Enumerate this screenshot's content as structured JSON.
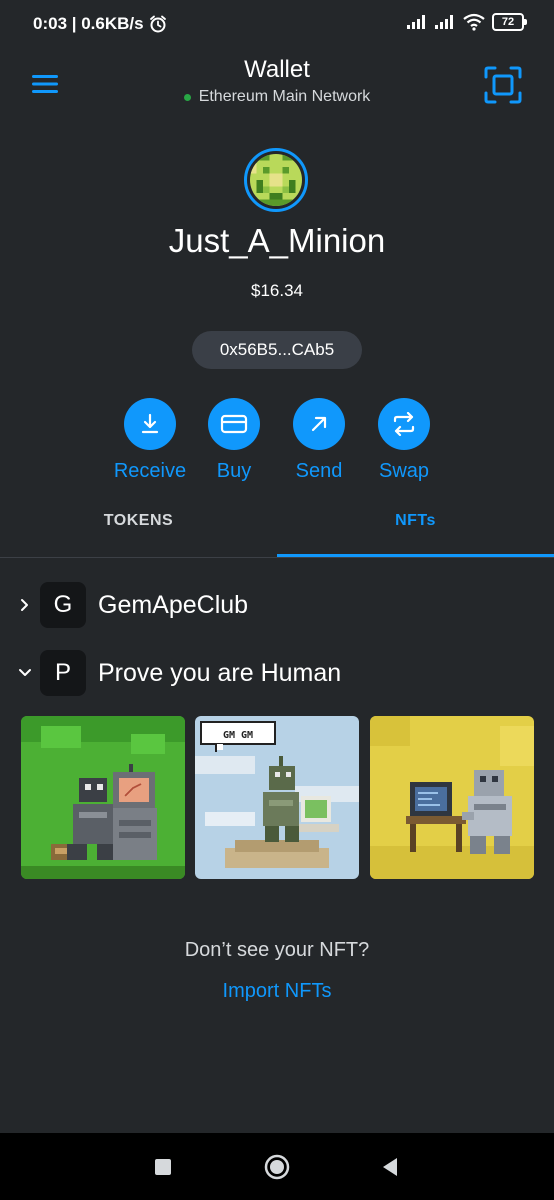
{
  "status_bar": {
    "time_speed": "0:03 | 0.6KB/s",
    "battery": "72"
  },
  "header": {
    "title": "Wallet",
    "network": "Ethereum Main Network"
  },
  "colors": {
    "background": "#24272a",
    "accent": "#1098fc",
    "network_dot": "#28a745",
    "pill": "#3a3f47"
  },
  "account": {
    "name": "Just_A_Minion",
    "balance": "$16.34",
    "address": "0x56B5...CAb5"
  },
  "actions": [
    {
      "label": "Receive",
      "icon": "download-icon"
    },
    {
      "label": "Buy",
      "icon": "card-icon"
    },
    {
      "label": "Send",
      "icon": "arrow-up-right-icon"
    },
    {
      "label": "Swap",
      "icon": "swap-icon"
    }
  ],
  "tabs": [
    {
      "label": "TOKENS",
      "active": false
    },
    {
      "label": "NFTs",
      "active": true
    }
  ],
  "collections": [
    {
      "initial": "G",
      "name": "GemApeClub",
      "expanded": false
    },
    {
      "initial": "P",
      "name": "Prove you are Human",
      "expanded": true
    }
  ],
  "nfts": [
    {
      "background": "#4cb034",
      "speech": ""
    },
    {
      "background": "#b7d2e6",
      "speech": "GM GM"
    },
    {
      "background": "#e3cf47",
      "speech": ""
    }
  ],
  "footer": {
    "question": "Don’t see your NFT?",
    "import_link": "Import NFTs"
  },
  "nav": [
    "square-icon",
    "circle-icon",
    "back-triangle-icon"
  ]
}
